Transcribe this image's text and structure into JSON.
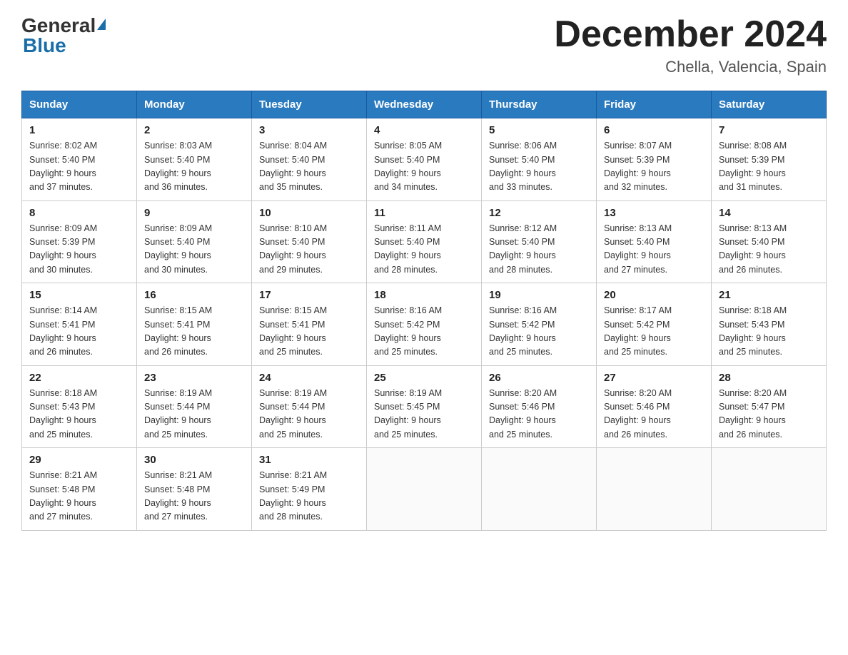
{
  "header": {
    "logo_general": "General",
    "logo_blue": "Blue",
    "title": "December 2024",
    "subtitle": "Chella, Valencia, Spain"
  },
  "days_of_week": [
    "Sunday",
    "Monday",
    "Tuesday",
    "Wednesday",
    "Thursday",
    "Friday",
    "Saturday"
  ],
  "weeks": [
    [
      {
        "day": "1",
        "sunrise": "8:02 AM",
        "sunset": "5:40 PM",
        "daylight": "9 hours and 37 minutes."
      },
      {
        "day": "2",
        "sunrise": "8:03 AM",
        "sunset": "5:40 PM",
        "daylight": "9 hours and 36 minutes."
      },
      {
        "day": "3",
        "sunrise": "8:04 AM",
        "sunset": "5:40 PM",
        "daylight": "9 hours and 35 minutes."
      },
      {
        "day": "4",
        "sunrise": "8:05 AM",
        "sunset": "5:40 PM",
        "daylight": "9 hours and 34 minutes."
      },
      {
        "day": "5",
        "sunrise": "8:06 AM",
        "sunset": "5:40 PM",
        "daylight": "9 hours and 33 minutes."
      },
      {
        "day": "6",
        "sunrise": "8:07 AM",
        "sunset": "5:39 PM",
        "daylight": "9 hours and 32 minutes."
      },
      {
        "day": "7",
        "sunrise": "8:08 AM",
        "sunset": "5:39 PM",
        "daylight": "9 hours and 31 minutes."
      }
    ],
    [
      {
        "day": "8",
        "sunrise": "8:09 AM",
        "sunset": "5:39 PM",
        "daylight": "9 hours and 30 minutes."
      },
      {
        "day": "9",
        "sunrise": "8:09 AM",
        "sunset": "5:40 PM",
        "daylight": "9 hours and 30 minutes."
      },
      {
        "day": "10",
        "sunrise": "8:10 AM",
        "sunset": "5:40 PM",
        "daylight": "9 hours and 29 minutes."
      },
      {
        "day": "11",
        "sunrise": "8:11 AM",
        "sunset": "5:40 PM",
        "daylight": "9 hours and 28 minutes."
      },
      {
        "day": "12",
        "sunrise": "8:12 AM",
        "sunset": "5:40 PM",
        "daylight": "9 hours and 28 minutes."
      },
      {
        "day": "13",
        "sunrise": "8:13 AM",
        "sunset": "5:40 PM",
        "daylight": "9 hours and 27 minutes."
      },
      {
        "day": "14",
        "sunrise": "8:13 AM",
        "sunset": "5:40 PM",
        "daylight": "9 hours and 26 minutes."
      }
    ],
    [
      {
        "day": "15",
        "sunrise": "8:14 AM",
        "sunset": "5:41 PM",
        "daylight": "9 hours and 26 minutes."
      },
      {
        "day": "16",
        "sunrise": "8:15 AM",
        "sunset": "5:41 PM",
        "daylight": "9 hours and 26 minutes."
      },
      {
        "day": "17",
        "sunrise": "8:15 AM",
        "sunset": "5:41 PM",
        "daylight": "9 hours and 25 minutes."
      },
      {
        "day": "18",
        "sunrise": "8:16 AM",
        "sunset": "5:42 PM",
        "daylight": "9 hours and 25 minutes."
      },
      {
        "day": "19",
        "sunrise": "8:16 AM",
        "sunset": "5:42 PM",
        "daylight": "9 hours and 25 minutes."
      },
      {
        "day": "20",
        "sunrise": "8:17 AM",
        "sunset": "5:42 PM",
        "daylight": "9 hours and 25 minutes."
      },
      {
        "day": "21",
        "sunrise": "8:18 AM",
        "sunset": "5:43 PM",
        "daylight": "9 hours and 25 minutes."
      }
    ],
    [
      {
        "day": "22",
        "sunrise": "8:18 AM",
        "sunset": "5:43 PM",
        "daylight": "9 hours and 25 minutes."
      },
      {
        "day": "23",
        "sunrise": "8:19 AM",
        "sunset": "5:44 PM",
        "daylight": "9 hours and 25 minutes."
      },
      {
        "day": "24",
        "sunrise": "8:19 AM",
        "sunset": "5:44 PM",
        "daylight": "9 hours and 25 minutes."
      },
      {
        "day": "25",
        "sunrise": "8:19 AM",
        "sunset": "5:45 PM",
        "daylight": "9 hours and 25 minutes."
      },
      {
        "day": "26",
        "sunrise": "8:20 AM",
        "sunset": "5:46 PM",
        "daylight": "9 hours and 25 minutes."
      },
      {
        "day": "27",
        "sunrise": "8:20 AM",
        "sunset": "5:46 PM",
        "daylight": "9 hours and 26 minutes."
      },
      {
        "day": "28",
        "sunrise": "8:20 AM",
        "sunset": "5:47 PM",
        "daylight": "9 hours and 26 minutes."
      }
    ],
    [
      {
        "day": "29",
        "sunrise": "8:21 AM",
        "sunset": "5:48 PM",
        "daylight": "9 hours and 27 minutes."
      },
      {
        "day": "30",
        "sunrise": "8:21 AM",
        "sunset": "5:48 PM",
        "daylight": "9 hours and 27 minutes."
      },
      {
        "day": "31",
        "sunrise": "8:21 AM",
        "sunset": "5:49 PM",
        "daylight": "9 hours and 28 minutes."
      },
      null,
      null,
      null,
      null
    ]
  ],
  "labels": {
    "sunrise": "Sunrise:",
    "sunset": "Sunset:",
    "daylight": "Daylight:"
  }
}
